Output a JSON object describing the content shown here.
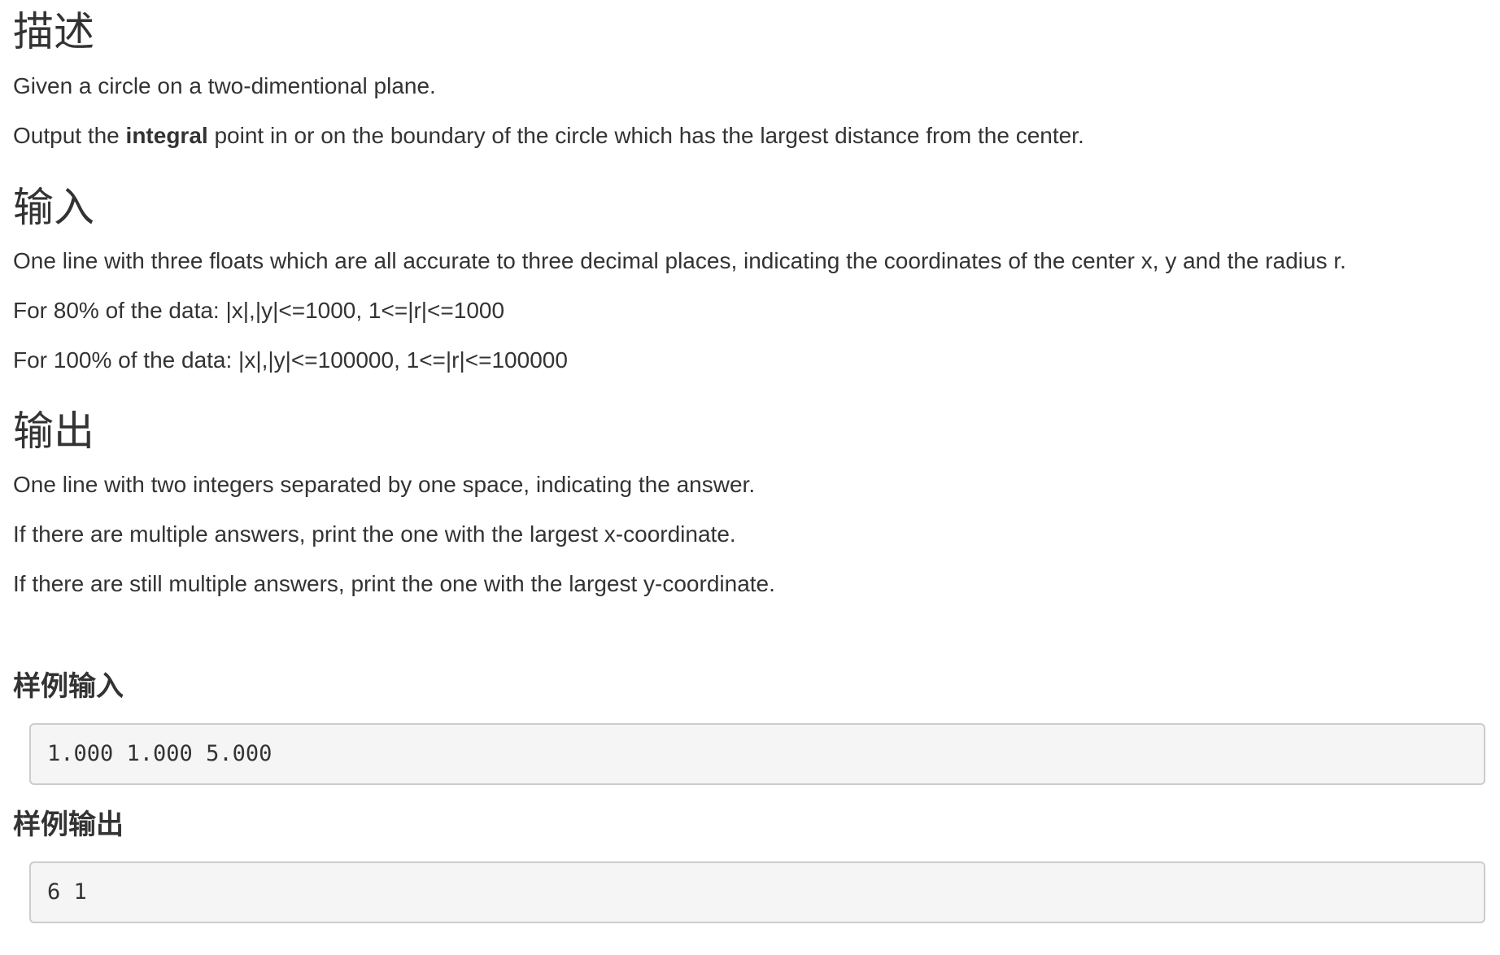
{
  "description": {
    "heading": "描述",
    "p1": "Given a circle on a two-dimentional plane.",
    "p2_before": "Output the ",
    "p2_bold": "integral",
    "p2_after": " point in or on the boundary of the circle which has the largest distance from the center."
  },
  "input": {
    "heading": "输入",
    "p1": "One line with three floats which are all accurate to three decimal places, indicating the coordinates of the center x, y and the radius r.",
    "p2": "For 80% of the data: |x|,|y|<=1000, 1<=|r|<=1000",
    "p3": "For 100% of the data: |x|,|y|<=100000, 1<=|r|<=100000"
  },
  "output": {
    "heading": "输出",
    "p1": "One line with two integers separated by one space, indicating the answer.",
    "p2": "If there are multiple answers, print the one with the largest x-coordinate.",
    "p3": "If there are still multiple answers, print the one with the largest y-coordinate."
  },
  "sample_input": {
    "heading": "样例输入",
    "code": "1.000 1.000 5.000"
  },
  "sample_output": {
    "heading": "样例输出",
    "code": "6 1"
  }
}
